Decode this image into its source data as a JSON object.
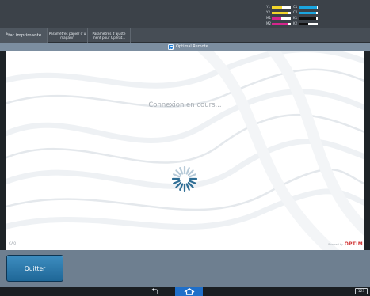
{
  "status": {
    "toners": [
      {
        "label": "Y1",
        "color": "#f2d52b",
        "level": 0.55
      },
      {
        "label": "C1",
        "color": "#1ba6e0",
        "level": 0.95
      },
      {
        "label": "Y2",
        "color": "#f2d52b",
        "level": 0.85
      },
      {
        "label": "C2",
        "color": "#1ba6e0",
        "level": 0.9
      },
      {
        "label": "M1",
        "color": "#d6258c",
        "level": 0.5
      },
      {
        "label": "K1",
        "color": "#111111",
        "level": 0.9
      },
      {
        "label": "M2",
        "color": "#d6258c",
        "level": 0.85
      },
      {
        "label": "K2",
        "color": "#111111",
        "level": 0.5
      }
    ]
  },
  "tabs": {
    "etat": "État imprimante",
    "papier": "Paramètres papier d’u magasin",
    "ajuste": "Paramètres d’ajuste ment pour Opérat..."
  },
  "app": {
    "title": "Optimal Remote",
    "logo_icon": "optimal-remote-logo",
    "menu_icon": "vertical-ellipsis-icon"
  },
  "main": {
    "connecting_text": "Connexion en cours...",
    "spinner_icon": "loading-spinner-icon",
    "corner_code": "CA0",
    "powered_label": "Powered by",
    "powered_brand": "OPTIM"
  },
  "bottom": {
    "quit_label": "Quitter"
  },
  "nav": {
    "back_icon": "back-arrow-icon",
    "home_icon": "home-icon",
    "keypad_label": "123"
  },
  "colors": {
    "accent": "#1f6fc9",
    "quit_button": "#2b77ab",
    "brand_red": "#d23a3a"
  }
}
